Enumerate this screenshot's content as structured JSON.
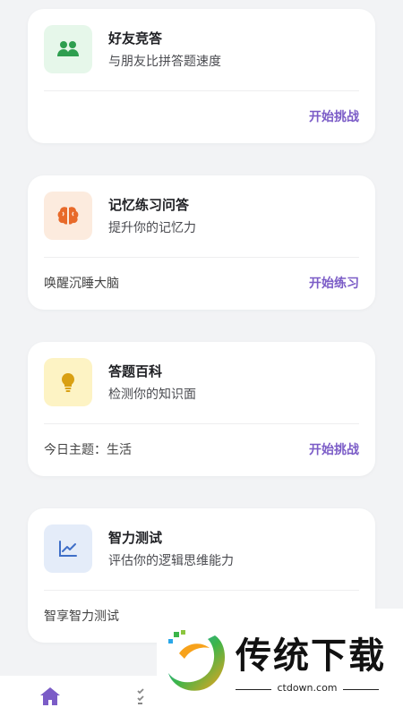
{
  "colors": {
    "accent_purple": "#7b5cc7",
    "green_bg": "#e6f7ea",
    "green_icon": "#2e9e4f",
    "orange_bg": "#fcebde",
    "orange_icon": "#e86a2a",
    "yellow_bg": "#fdf3c4",
    "yellow_icon": "#d9a013",
    "blue_bg": "#e4ecf9",
    "blue_icon": "#3f6fc8"
  },
  "cards": [
    {
      "title": "好友竞答",
      "subtitle": "与朋友比拼答题速度",
      "note": "",
      "action": "开始挑战",
      "icon": "people-group-icon"
    },
    {
      "title": "记忆练习问答",
      "subtitle": "提升你的记忆力",
      "note": "唤醒沉睡大脑",
      "action": "开始练习",
      "icon": "brain-icon"
    },
    {
      "title": "答题百科",
      "subtitle": "检测你的知识面",
      "note": "今日主题：生活",
      "action": "开始挑战",
      "icon": "lightbulb-icon"
    },
    {
      "title": "智力测试",
      "subtitle": "评估你的逻辑思维能力",
      "note": "智享智力测试",
      "action": "",
      "icon": "line-chart-icon"
    }
  ],
  "bottom_nav": {
    "items": [
      "home-icon",
      "checklist-icon"
    ]
  },
  "watermark": {
    "text": "传统下载",
    "url": "ctdown.com"
  }
}
